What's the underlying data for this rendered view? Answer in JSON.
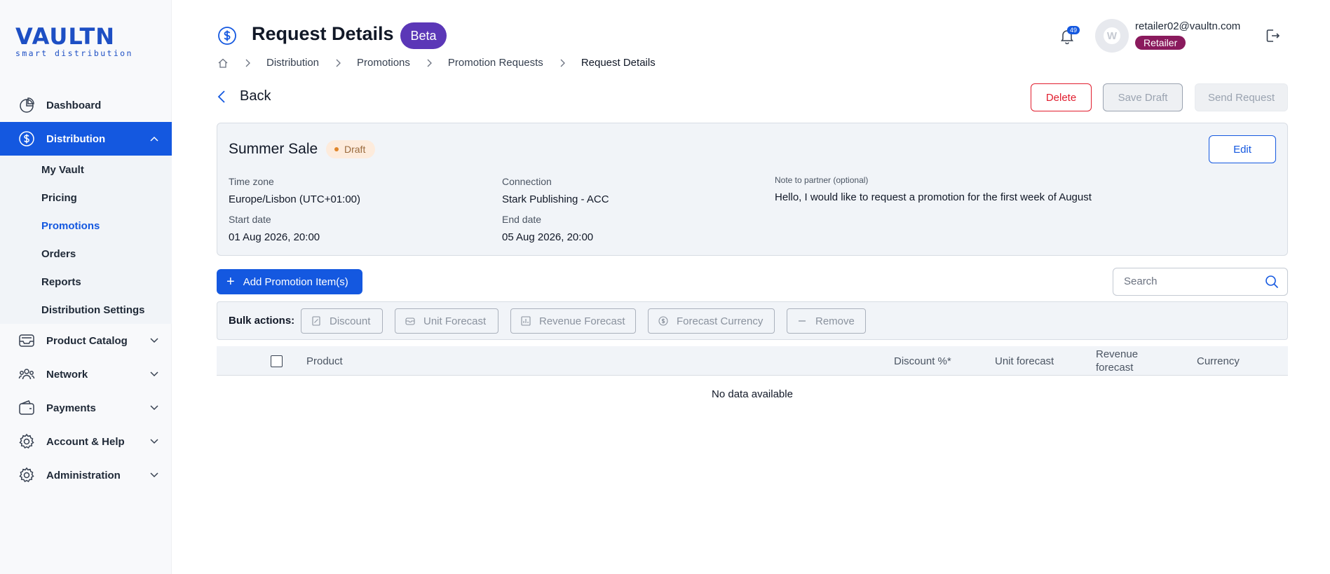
{
  "logo": {
    "main": "VAULTN",
    "sub": "smart distribution"
  },
  "sidebar": {
    "items": [
      {
        "label": "Dashboard",
        "icon": "dashboard-icon"
      },
      {
        "label": "Distribution",
        "icon": "dollar-circle-icon",
        "active": true,
        "children": [
          "My Vault",
          "Pricing",
          "Promotions",
          "Orders",
          "Reports",
          "Distribution Settings"
        ],
        "current_child": "Promotions"
      },
      {
        "label": "Product Catalog",
        "icon": "inbox-icon"
      },
      {
        "label": "Network",
        "icon": "users-icon"
      },
      {
        "label": "Payments",
        "icon": "wallet-icon"
      },
      {
        "label": "Account & Help",
        "icon": "gear-icon"
      },
      {
        "label": "Administration",
        "icon": "admin-gear-icon"
      }
    ]
  },
  "header": {
    "title": "Request Details",
    "badge": "Beta",
    "notifications": "49",
    "user_email": "retailer02@vaultn.com",
    "user_role": "Retailer",
    "avatar_letter": "W"
  },
  "breadcrumb": [
    "Distribution",
    "Promotions",
    "Promotion Requests",
    "Request Details"
  ],
  "actions": {
    "back": "Back",
    "delete": "Delete",
    "save_draft": "Save Draft",
    "send_request": "Send Request"
  },
  "promotion": {
    "name": "Summer Sale",
    "status": "Draft",
    "edit": "Edit",
    "time_zone_label": "Time zone",
    "time_zone": "Europe/Lisbon (UTC+01:00)",
    "connection_label": "Connection",
    "connection": "Stark Publishing - ACC",
    "note_label": "Note to partner (optional)",
    "note": "Hello, I would like to request a promotion for the first week of August",
    "start_label": "Start date",
    "start": "01 Aug 2026, 20:00",
    "end_label": "End date",
    "end": "05 Aug 2026, 20:00"
  },
  "items": {
    "add_label": "Add Promotion Item(s)",
    "search_placeholder": "Search",
    "bulk_label": "Bulk actions:",
    "bulk_actions": [
      "Discount",
      "Unit Forecast",
      "Revenue Forecast",
      "Forecast Currency",
      "Remove"
    ],
    "columns": [
      "Product",
      "Discount %*",
      "Unit forecast",
      "Revenue forecast",
      "Currency"
    ],
    "empty": "No data available"
  },
  "colors": {
    "primary": "#1458e0",
    "beta": "#5b37b7",
    "role": "#8a1a5d",
    "danger": "#e11d2e",
    "draft_bg": "#fdebdc"
  }
}
